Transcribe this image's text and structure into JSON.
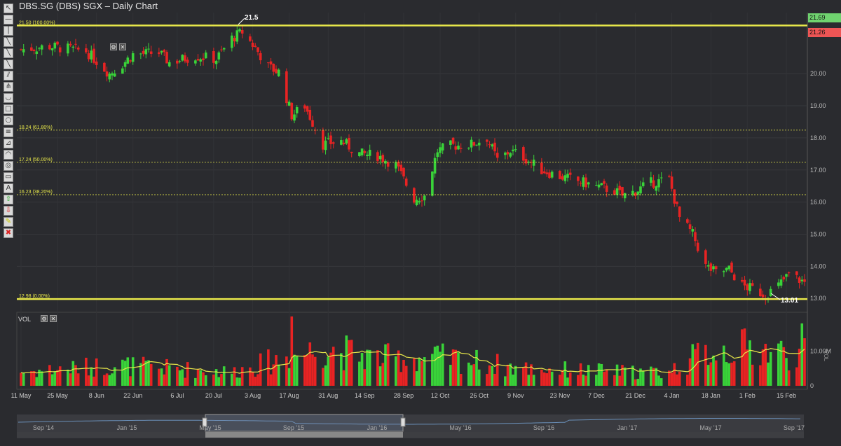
{
  "title": "DBS.SG (DBS) SGX – Daily Chart",
  "toolbar": [
    "cursor",
    "hline",
    "vline",
    "trendline",
    "ray",
    "line",
    "channel",
    "pitchfork",
    "arc",
    "rect",
    "ellipse",
    "fib-retrace",
    "fib-fan",
    "fib-arc",
    "fib-circle",
    "gann",
    "text",
    "arrow-up",
    "arrow-down",
    "highlighter",
    "eraser"
  ],
  "toolbar_glyphs": [
    "↖",
    "—",
    "│",
    "╲",
    "╲",
    "╲",
    "⫽",
    "⋔",
    "◡",
    "□",
    "○",
    "≡",
    "⊿",
    "◠",
    "◎",
    "▭",
    "A",
    "⇧",
    "⇩",
    "✎",
    "✖"
  ],
  "price_axis": {
    "labels": [
      "20.00",
      "19.00",
      "18.00",
      "17.00",
      "16.00",
      "15.00",
      "14.00",
      "13.00"
    ],
    "min": 12.7,
    "max": 21.9
  },
  "tags": {
    "high": "21.69",
    "last": "21.26",
    "high_color": "#6fd36f",
    "last_color": "#ee5555"
  },
  "fib_levels": [
    {
      "label": "21.50 (100.00%)",
      "value": 21.5,
      "style": "solid"
    },
    {
      "label": "18.24 (61.80%)",
      "value": 18.24,
      "style": "dotted"
    },
    {
      "label": "17.24 (50.00%)",
      "value": 17.24,
      "style": "dotted"
    },
    {
      "label": "16.23 (38.20%)",
      "value": 16.23,
      "style": "dotted"
    },
    {
      "label": "12.98 (0.00%)",
      "value": 12.98,
      "style": "solid"
    }
  ],
  "annotations": [
    {
      "text": "21.5"
    },
    {
      "text": "13.01"
    }
  ],
  "volume": {
    "title": "VOL",
    "axis_labels": [
      "10.00M",
      "0"
    ],
    "axis_title": "VOL",
    "max": 20
  },
  "x_labels": [
    "11 May",
    "25 May",
    "8 Jun",
    "22 Jun",
    "6 Jul",
    "20 Jul",
    "3 Aug",
    "17 Aug",
    "31 Aug",
    "14 Sep",
    "28 Sep",
    "12 Oct",
    "26 Oct",
    "9 Nov",
    "23 Nov",
    "7 Dec",
    "21 Dec",
    "4 Jan",
    "18 Jan",
    "1 Feb",
    "15 Feb"
  ],
  "navigator_labels": [
    "Sep '14",
    "Jan '15",
    "May '15",
    "Sep '15",
    "Jan '16",
    "May '16",
    "Sep '16",
    "Jan '17",
    "May '17",
    "Sep '17"
  ],
  "colors": {
    "up": "#39d339",
    "down": "#e82323",
    "fib": "#e8e84a",
    "ma": "#e8e84a"
  },
  "chart_data": {
    "type": "candlestick",
    "title": "DBS.SG (DBS) SGX – Daily Chart",
    "x_range": [
      "2015-04-30",
      "2016-02-25"
    ],
    "y_range": [
      12.7,
      21.9
    ],
    "close_anchors": [
      [
        "2015-04-30",
        20.75
      ],
      [
        "2015-05-11",
        20.85
      ],
      [
        "2015-05-25",
        20.7
      ],
      [
        "2015-06-03",
        20.0
      ],
      [
        "2015-06-08",
        20.3
      ],
      [
        "2015-06-12",
        20.6
      ],
      [
        "2015-06-22",
        20.65
      ],
      [
        "2015-06-26",
        20.35
      ],
      [
        "2015-07-06",
        20.55
      ],
      [
        "2015-07-14",
        20.45
      ],
      [
        "2015-07-20",
        21.1
      ],
      [
        "2015-07-24",
        21.3
      ],
      [
        "2015-07-29",
        20.8
      ],
      [
        "2015-08-03",
        20.2
      ],
      [
        "2015-08-07",
        20.05
      ],
      [
        "2015-08-12",
        18.7
      ],
      [
        "2015-08-17",
        19.0
      ],
      [
        "2015-08-24",
        17.8
      ],
      [
        "2015-08-31",
        17.9
      ],
      [
        "2015-09-07",
        17.5
      ],
      [
        "2015-09-14",
        17.45
      ],
      [
        "2015-09-21",
        17.15
      ],
      [
        "2015-09-28",
        16.1
      ],
      [
        "2015-10-02",
        16.2
      ],
      [
        "2015-10-07",
        17.6
      ],
      [
        "2015-10-12",
        17.75
      ],
      [
        "2015-10-20",
        17.8
      ],
      [
        "2015-10-26",
        18.0
      ],
      [
        "2015-10-30",
        17.3
      ],
      [
        "2015-11-04",
        17.6
      ],
      [
        "2015-11-09",
        17.4
      ],
      [
        "2015-11-16",
        17.0
      ],
      [
        "2015-11-23",
        16.8
      ],
      [
        "2015-12-07",
        16.5
      ],
      [
        "2015-12-14",
        16.35
      ],
      [
        "2015-12-17",
        16.2
      ],
      [
        "2015-12-21",
        16.3
      ],
      [
        "2015-12-28",
        16.6
      ],
      [
        "2016-01-04",
        16.7
      ],
      [
        "2016-01-08",
        15.5
      ],
      [
        "2016-01-13",
        15.0
      ],
      [
        "2016-01-18",
        14.0
      ],
      [
        "2016-01-22",
        13.8
      ],
      [
        "2016-01-27",
        13.9
      ],
      [
        "2016-02-01",
        13.4
      ],
      [
        "2016-02-05",
        13.3
      ],
      [
        "2016-02-10",
        13.1
      ],
      [
        "2016-02-15",
        13.4
      ],
      [
        "2016-02-19",
        13.75
      ],
      [
        "2016-02-25",
        13.5
      ]
    ],
    "volume_anchors_millions": [
      [
        "2015-04-30",
        4
      ],
      [
        "2015-06-05",
        6
      ],
      [
        "2015-07-20",
        4
      ],
      [
        "2015-08-14",
        9
      ],
      [
        "2015-08-24",
        11
      ],
      [
        "2015-09-14",
        8
      ],
      [
        "2015-10-12",
        8
      ],
      [
        "2015-11-09",
        5
      ],
      [
        "2015-12-21",
        4
      ],
      [
        "2016-01-04",
        4
      ],
      [
        "2016-01-18",
        10
      ],
      [
        "2016-02-01",
        11
      ],
      [
        "2016-02-25",
        9
      ]
    ],
    "volume_spikes_millions": [
      [
        "2015-08-12",
        20
      ],
      [
        "2016-02-24",
        18
      ]
    ],
    "series": [
      {
        "name": "VOL",
        "type": "volume"
      }
    ],
    "fib_retracement": {
      "high": 21.5,
      "low": 12.98
    }
  }
}
